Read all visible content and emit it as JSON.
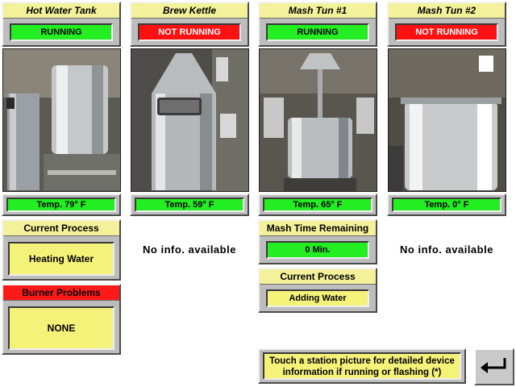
{
  "stations": [
    {
      "title": "Hot Water Tank",
      "status": "RUNNING",
      "temp": "Temp. 79° F"
    },
    {
      "title": "Brew Kettle",
      "status": "NOT RUNNING",
      "temp": "Temp. 59° F"
    },
    {
      "title": "Mash Tun #1",
      "status": "RUNNING",
      "temp": "Temp. 65° F"
    },
    {
      "title": "Mash Tun #2",
      "status": "NOT RUNNING",
      "temp": "Temp. 0° F"
    }
  ],
  "hot_water": {
    "process_title": "Current Process",
    "process_value": "Heating Water",
    "burner_title": "Burner Problems",
    "burner_value": "NONE"
  },
  "brew_kettle": {
    "no_info": "No info. available"
  },
  "mash_tun_1": {
    "mash_time_title": "Mash Time Remaining",
    "mash_time_value": "0 Min.",
    "process_title": "Current Process",
    "process_value": "Adding Water"
  },
  "mash_tun_2": {
    "no_info": "No info. available"
  },
  "footer": {
    "hint": "Touch a station picture for detailed device information if running or flashing (*)",
    "enter_icon": "enter-return-icon"
  },
  "colors": {
    "running": "#22ee22",
    "not_running": "#ff1111",
    "title_bg": "#f3f29a",
    "value_bg": "#f5f27a"
  }
}
